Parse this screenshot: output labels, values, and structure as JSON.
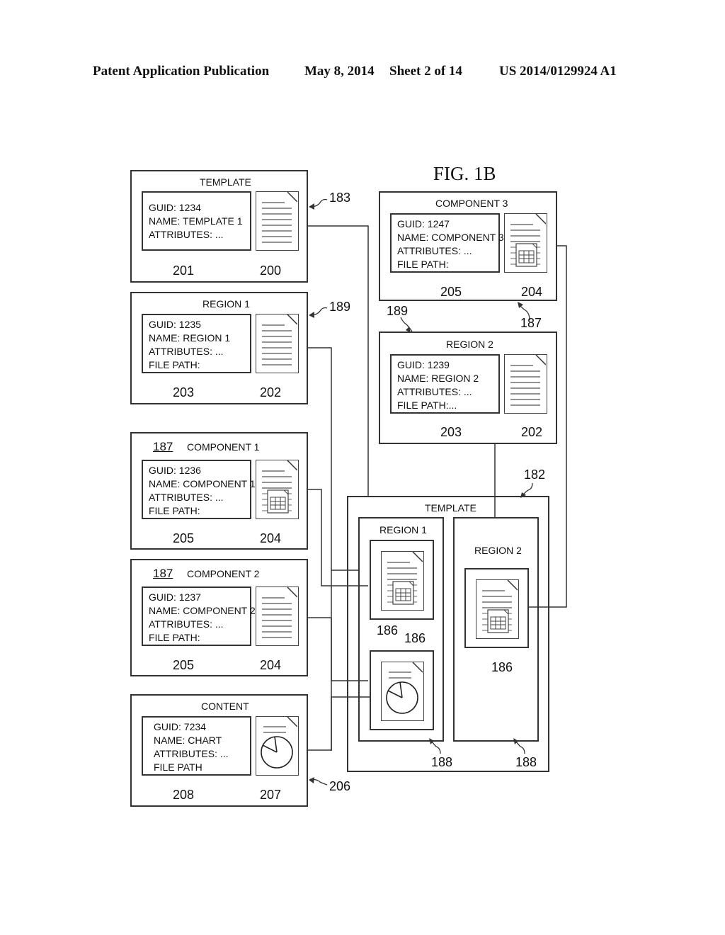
{
  "header": {
    "left": "Patent Application Publication",
    "date": "May 8, 2014",
    "sheet": "Sheet 2 of 14",
    "number": "US 2014/0129924 A1"
  },
  "figure_label": "FIG. 1B",
  "left_column": [
    {
      "title": "TEMPLATE",
      "ref_label": "",
      "lines": [
        "GUID: 1234",
        "NAME: TEMPLATE 1",
        "ATTRIBUTES: ..."
      ],
      "info_ref": "201",
      "icon_ref": "200",
      "icon": "document-icon",
      "box_ref": "183"
    },
    {
      "title": "REGION 1",
      "ref_label": "",
      "lines": [
        "GUID: 1235",
        "NAME: REGION 1",
        "ATTRIBUTES: ...",
        "FILE PATH:"
      ],
      "info_ref": "203",
      "icon_ref": "202",
      "icon": "document-icon",
      "box_ref": "189"
    },
    {
      "title": "COMPONENT 1",
      "ref_label": "187",
      "lines": [
        "GUID: 1236",
        "NAME: COMPONENT 1",
        "ATTRIBUTES: ...",
        "FILE PATH:"
      ],
      "info_ref": "205",
      "icon_ref": "204",
      "icon": "document-table-icon",
      "box_ref": ""
    },
    {
      "title": "COMPONENT 2",
      "ref_label": "187",
      "lines": [
        "GUID: 1237",
        "NAME: COMPONENT 2",
        "ATTRIBUTES: ...",
        "FILE PATH:"
      ],
      "info_ref": "205",
      "icon_ref": "204",
      "icon": "document-icon",
      "box_ref": ""
    },
    {
      "title": "CONTENT",
      "ref_label": "",
      "lines": [
        "GUID: 7234",
        "NAME: CHART",
        "ATTRIBUTES: ...",
        "FILE PATH"
      ],
      "info_ref": "208",
      "icon_ref": "207",
      "icon": "document-chart-icon",
      "box_ref": "206"
    }
  ],
  "right_column": [
    {
      "title": "COMPONENT 3",
      "lines": [
        "GUID: 1247",
        "NAME: COMPONENT 3",
        "ATTRIBUTES: ...",
        "FILE PATH:"
      ],
      "info_ref": "205",
      "icon_ref": "204",
      "icon": "document-table-icon",
      "box_ref": "187"
    },
    {
      "title": "REGION 2",
      "lines": [
        "GUID: 1239",
        "NAME: REGION 2",
        "ATTRIBUTES: ...",
        "FILE PATH:..."
      ],
      "info_ref": "203",
      "icon_ref": "202",
      "icon": "document-icon",
      "box_ref": "189"
    }
  ],
  "composite": {
    "title": "TEMPLATE",
    "ref": "182",
    "region1": {
      "title": "REGION 1",
      "ref": "188",
      "slot_refs": [
        "186",
        "186"
      ]
    },
    "region2": {
      "title": "REGION 2",
      "ref": "188",
      "slot_ref": "186"
    }
  }
}
